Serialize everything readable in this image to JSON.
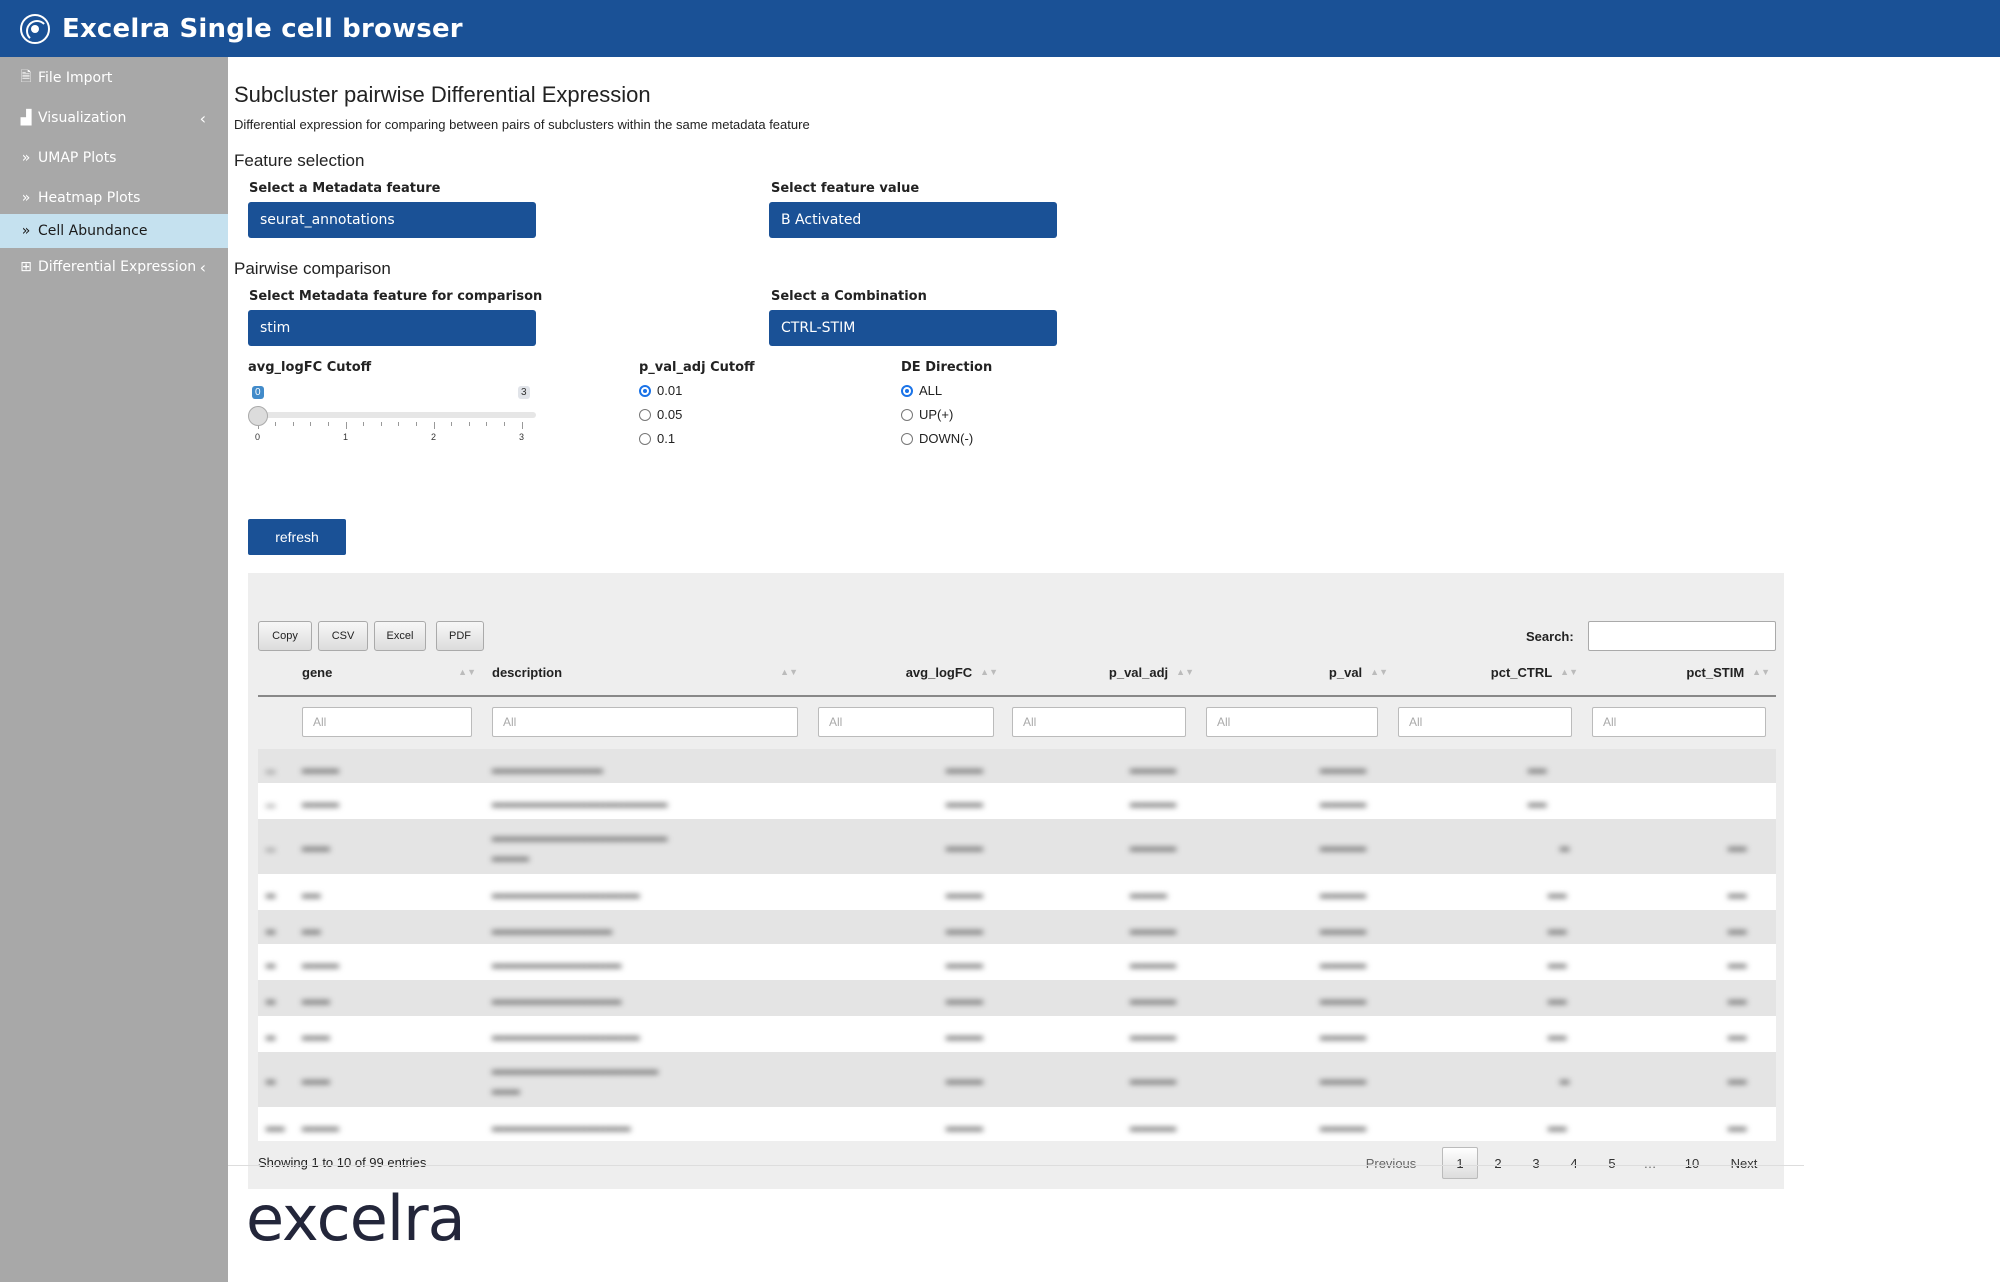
{
  "app": {
    "title": "Excelra Single cell browser",
    "brand_icon": "atom-logo-icon"
  },
  "sidebar": {
    "items": [
      {
        "label": "File Import",
        "icon": "file-icon",
        "chevron": ""
      },
      {
        "label": "Visualization",
        "icon": "bar-chart-icon",
        "chevron": "‹"
      },
      {
        "label": "UMAP Plots",
        "icon": "double-chevron-right-icon",
        "chevron": ""
      },
      {
        "label": "Heatmap Plots",
        "icon": "double-chevron-right-icon",
        "chevron": ""
      },
      {
        "label": "Cell Abundance",
        "icon": "double-chevron-right-icon",
        "chevron": "",
        "active": true
      },
      {
        "label": "Differential Expression",
        "icon": "table-icon",
        "chevron": "‹"
      }
    ]
  },
  "page": {
    "title": "Subcluster pairwise Differential Expression",
    "subtitle": "Differential expression for comparing between pairs of subclusters within the same metadata feature"
  },
  "feature_selection": {
    "heading": "Feature selection",
    "metadata_label": "Select a Metadata feature",
    "metadata_value": "seurat_annotations",
    "value_label": "Select feature value",
    "value_value": "B Activated"
  },
  "pairwise": {
    "heading": "Pairwise comparison",
    "compare_label": "Select Metadata feature for comparison",
    "compare_value": "stim",
    "combo_label": "Select a Combination",
    "combo_value": "CTRL-STIM"
  },
  "slider": {
    "label": "avg_logFC Cutoff",
    "value": "0",
    "max": "3",
    "tick_labels": [
      "0",
      "1",
      "2",
      "3"
    ]
  },
  "pval": {
    "label": "p_val_adj Cutoff",
    "options": [
      "0.01",
      "0.05",
      "0.1"
    ],
    "selected": "0.01"
  },
  "direction": {
    "label": "DE Direction",
    "options": [
      "ALL",
      "UP(+)",
      "DOWN(-)"
    ],
    "selected": "ALL"
  },
  "refresh_label": "refresh",
  "table": {
    "buttons": [
      "Copy",
      "CSV",
      "Excel",
      "PDF"
    ],
    "search_label": "Search:",
    "columns": [
      "gene",
      "description",
      "avg_logFC",
      "p_val_adj",
      "p_val",
      "pct_CTRL",
      "pct_STIM"
    ],
    "filter_placeholder": "All",
    "info": "Showing 1 to 10 of 99 entries",
    "pagination": [
      "Previous",
      "1",
      "2",
      "3",
      "4",
      "5",
      "…",
      "10",
      "Next"
    ],
    "current_page": "1"
  },
  "footer": {
    "logo_text": "excelra"
  },
  "colors": {
    "primary": "#1a5196",
    "sidebar": "#a8a8a8",
    "active": "#c5e1ef"
  }
}
